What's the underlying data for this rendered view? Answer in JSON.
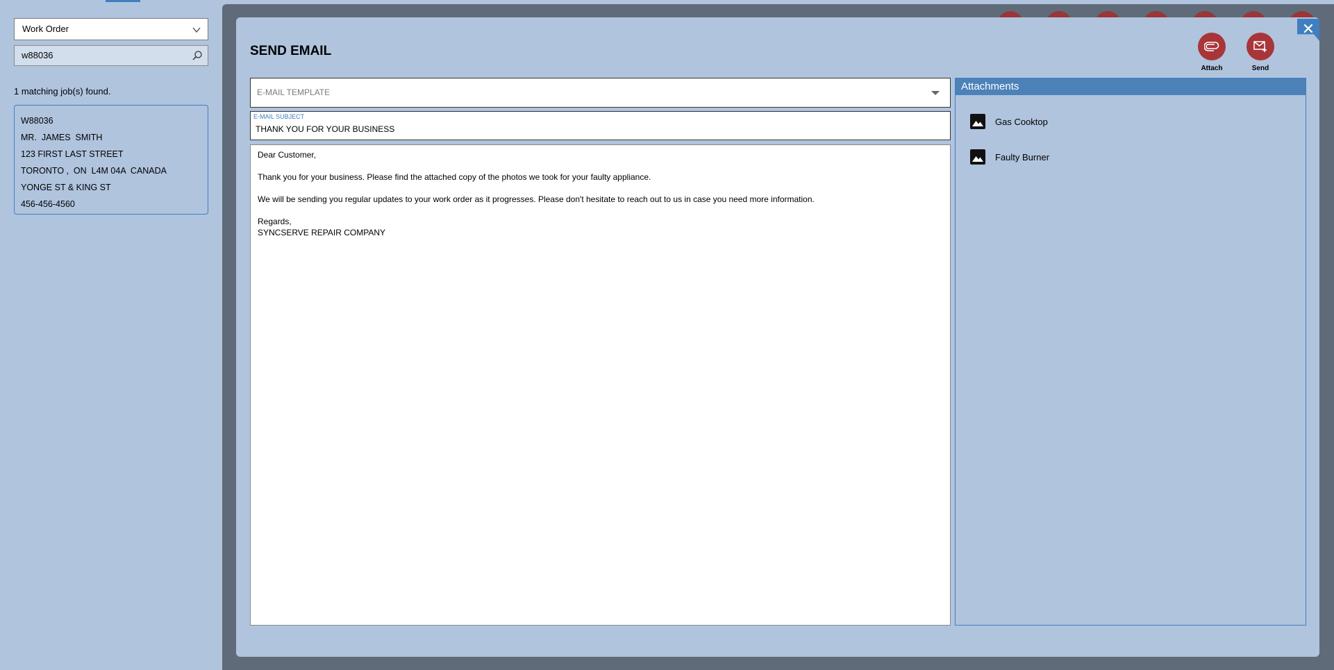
{
  "sidebar": {
    "search_type": "Work Order",
    "search_value": "w88036",
    "match_count": "1 matching job(s) found.",
    "job": {
      "lines": [
        "W88036",
        "MR.  JAMES  SMITH",
        "123 FIRST LAST STREET",
        "TORONTO ,  ON  L4M 04A  CANADA",
        "YONGE ST & KING ST",
        "456-456-4560"
      ]
    }
  },
  "dialog": {
    "title": "SEND EMAIL",
    "close_glyph": "✕",
    "actions": {
      "attach_label": "Attach",
      "send_label": "Send"
    },
    "template_placeholder": "E-MAIL TEMPLATE",
    "subject_label": "E-MAIL SUBJECT",
    "subject_value": "THANK YOU FOR YOUR BUSINESS",
    "body": {
      "greeting": "Dear Customer,",
      "para1": "Thank you for your business. Please find the attached copy of the photos we took for your faulty appliance.",
      "para2": "We will be sending you regular updates to your work order as it progresses. Please don't hesitate to reach out to us in case you need more information.",
      "closing": "Regards,",
      "signature": "SYNCSERVE REPAIR COMPANY"
    },
    "attachments": {
      "header": "Attachments",
      "items": [
        {
          "name": "Gas Cooktop",
          "icon": "image-icon"
        },
        {
          "name": "Faulty Burner",
          "icon": "image-icon"
        }
      ]
    }
  },
  "colors": {
    "background": "#b0c4de",
    "accent": "#3f7fbf",
    "action_red": "#a83539",
    "overlay": "#5f6b78"
  }
}
